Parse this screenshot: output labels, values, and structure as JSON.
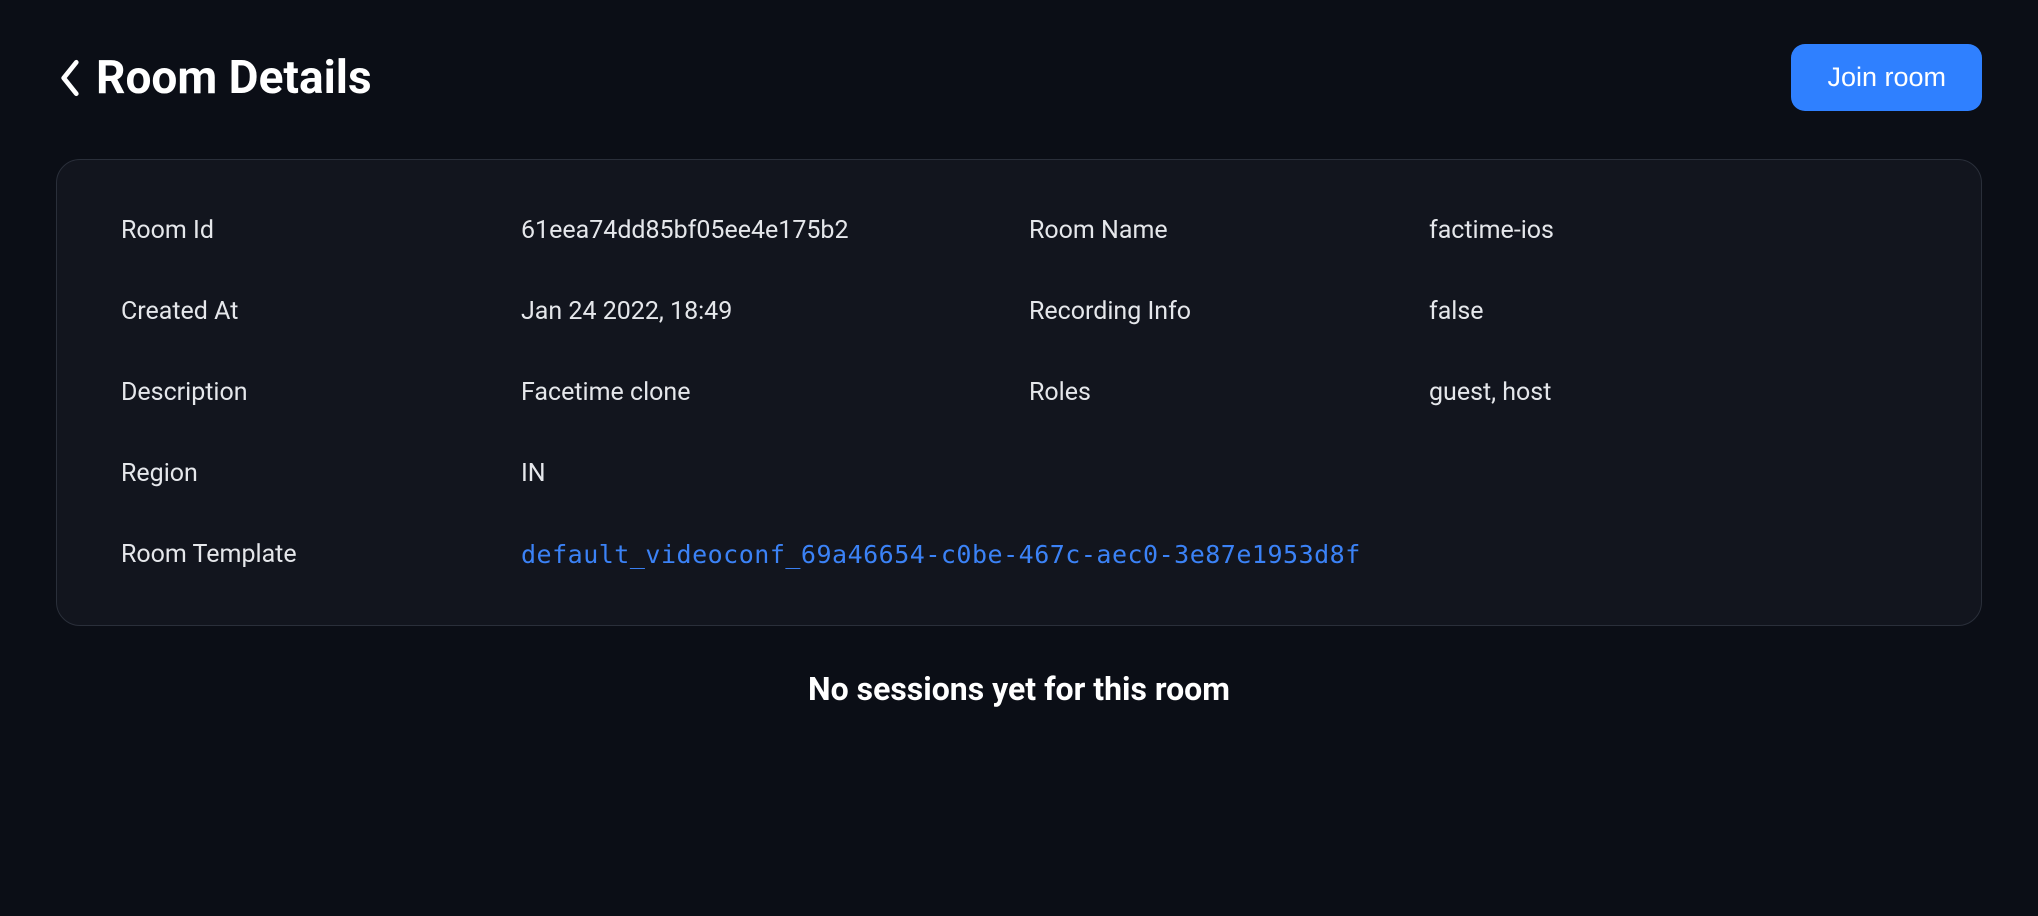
{
  "header": {
    "title": "Room Details",
    "join_button_label": "Join room"
  },
  "details": {
    "room_id": {
      "label": "Room Id",
      "value": "61eea74dd85bf05ee4e175b2"
    },
    "room_name": {
      "label": "Room Name",
      "value": "factime-ios"
    },
    "created_at": {
      "label": "Created At",
      "value": "Jan 24 2022, 18:49"
    },
    "recording_info": {
      "label": "Recording Info",
      "value": "false"
    },
    "description": {
      "label": "Description",
      "value": "Facetime clone"
    },
    "roles": {
      "label": "Roles",
      "value": "guest,  host"
    },
    "region": {
      "label": "Region",
      "value": "IN"
    },
    "room_template": {
      "label": "Room Template",
      "value": "default_videoconf_69a46654-c0be-467c-aec0-3e87e1953d8f"
    }
  },
  "sessions_empty_message": "No sessions yet for this room"
}
